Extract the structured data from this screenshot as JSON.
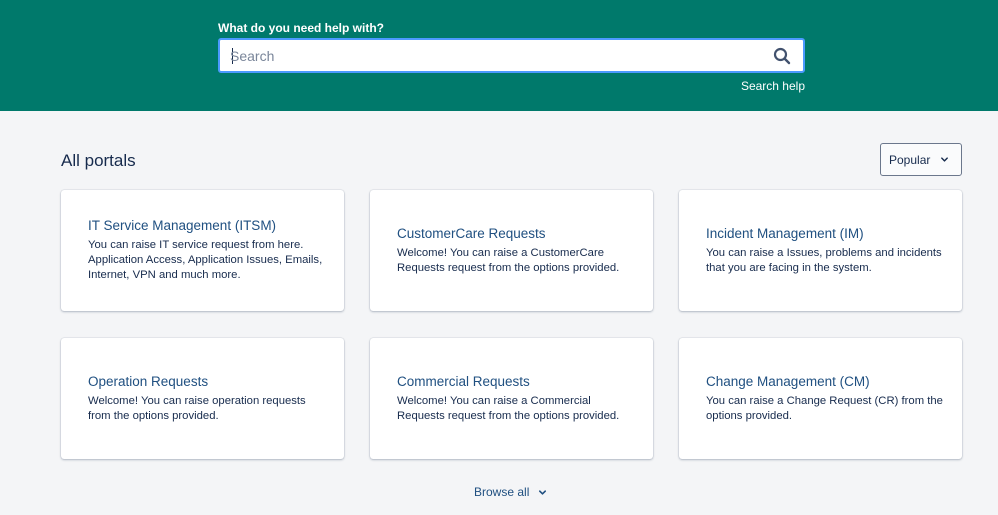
{
  "hero": {
    "help_label": "What do you need help with?",
    "search_placeholder": "Search",
    "search_help_link": "Search help",
    "background_color": "#00796b"
  },
  "portals": {
    "section_title": "All portals",
    "sort": {
      "selected": "Popular"
    },
    "cards": [
      {
        "title": "IT Service Management (ITSM)",
        "description": "You can raise IT service request from here. Application Access, Application Issues, Emails, Internet, VPN and much more."
      },
      {
        "title": "CustomerCare Requests",
        "description": "Welcome! You can raise a CustomerCare Requests request from the options provided."
      },
      {
        "title": "Incident Management (IM)",
        "description": "You can raise a Issues, problems and incidents that you are facing in the system."
      },
      {
        "title": "Operation Requests",
        "description": "Welcome! You can raise operation requests from the options provided."
      },
      {
        "title": "Commercial Requests",
        "description": "Welcome! You can raise a Commercial Requests request from the options provided."
      },
      {
        "title": "Change Management (CM)",
        "description": "You can raise a Change Request (CR) from the options provided."
      }
    ],
    "browse_all": "Browse all"
  },
  "icons": {
    "search": "search-icon",
    "sort_chevron": "chevron-down-icon",
    "browse_chevron": "chevron-down-icon"
  }
}
